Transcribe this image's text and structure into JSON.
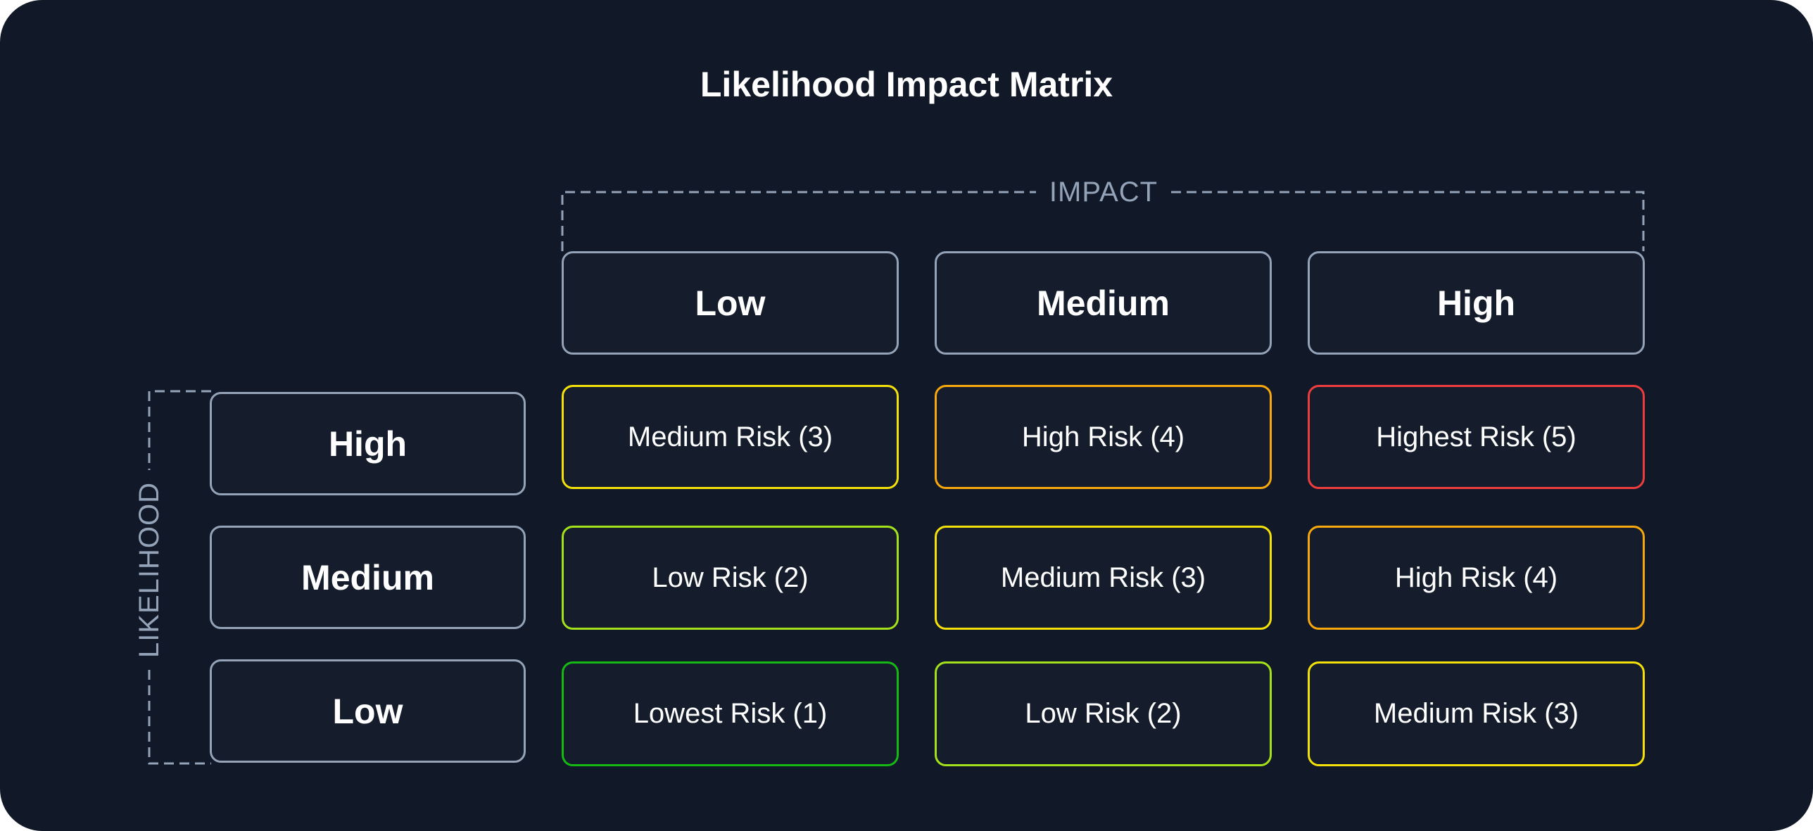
{
  "title": "Likelihood Impact Matrix",
  "impact_axis": {
    "label": "IMPACT",
    "levels": [
      "Low",
      "Medium",
      "High"
    ]
  },
  "likelihood_axis": {
    "label": "LIKELIHOOD",
    "levels": [
      "High",
      "Medium",
      "Low"
    ]
  },
  "colors": {
    "background": "#111827",
    "cell_fill": "#151d2c",
    "neutral_border": "#94a3b8",
    "risk_1": "#16b914",
    "risk_2": "#a3e21a",
    "risk_3": "#f5e10a",
    "risk_4": "#f7a80c",
    "risk_5": "#ef3d3d"
  },
  "matrix": [
    [
      {
        "label": "Medium Risk (3)",
        "score": 3
      },
      {
        "label": "High Risk (4)",
        "score": 4
      },
      {
        "label": "Highest Risk (5)",
        "score": 5
      }
    ],
    [
      {
        "label": "Low Risk (2)",
        "score": 2
      },
      {
        "label": "Medium Risk (3)",
        "score": 3
      },
      {
        "label": "High Risk (4)",
        "score": 4
      }
    ],
    [
      {
        "label": "Lowest Risk (1)",
        "score": 1
      },
      {
        "label": "Low Risk (2)",
        "score": 2
      },
      {
        "label": "Medium Risk (3)",
        "score": 3
      }
    ]
  ]
}
